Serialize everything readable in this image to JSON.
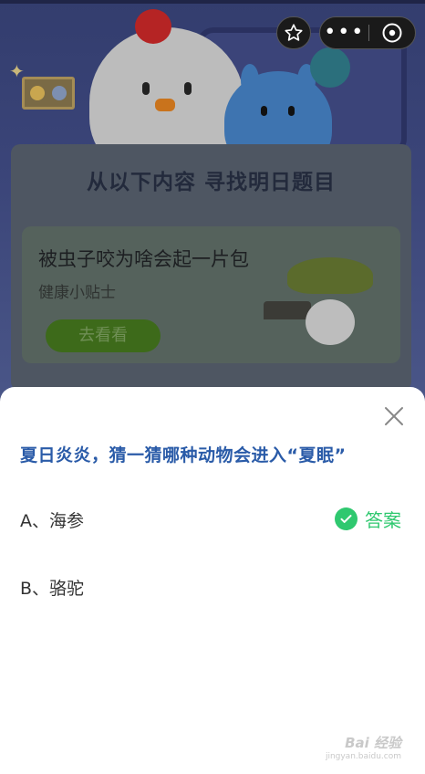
{
  "background_page": {
    "card_title": "从以下内容  寻找明日题目",
    "tip": {
      "title": "被虫子咬为啥会起一片包",
      "subtitle": "健康小贴士",
      "button_label": "去看看"
    }
  },
  "capsule": {
    "favorite_icon": "star-icon",
    "more_icon": "more-dots-icon",
    "more_label": "•••",
    "close_icon": "close-circle-icon"
  },
  "sheet": {
    "question": "夏日炎炎，猜一猜哪种动物会进入“夏眠”",
    "options": [
      {
        "label": "A、海参",
        "is_answer": true
      },
      {
        "label": "B、骆驼",
        "is_answer": false
      }
    ],
    "answer_label": "答案",
    "answer_color": "#2fc86f",
    "question_color": "#2a5ba8"
  },
  "watermark": {
    "brand": "Bai 经验",
    "url": "jingyan.baidu.com"
  }
}
